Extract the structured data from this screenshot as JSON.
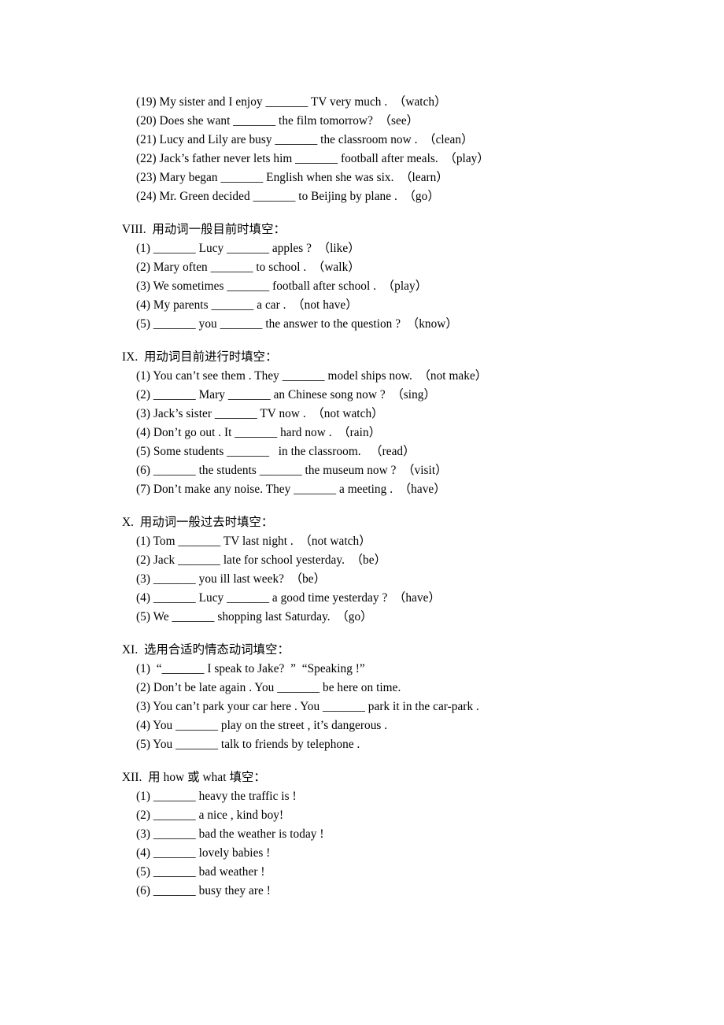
{
  "document": {
    "blocks": [
      {
        "id": "continuation-items",
        "heading": "",
        "items": [
          "(19) My sister and I enjoy _______ TV very much .  （watch）",
          "(20) Does she want _______ the film tomorrow?  （see）",
          "(21) Lucy and Lily are busy _______ the classroom now .  （clean）",
          "(22) Jack’s father never lets him _______ football after meals.  （play）",
          "(23) Mary began _______ English when she was six.  （learn）",
          "(24) Mr. Green decided _______ to Beijing by plane .  （go）"
        ]
      },
      {
        "id": "section-viii",
        "heading": "VIII.  用动词一般目前时填空：",
        "items": [
          "(1) _______ Lucy _______ apples ?  （like）",
          "(2) Mary often _______ to school .  （walk）",
          "(3) We sometimes _______ football after school .  （play）",
          "(4) My parents _______ a car .  （not have）",
          "(5) _______ you _______ the answer to the question ?  （know）"
        ]
      },
      {
        "id": "section-ix",
        "heading": "IX.  用动词目前进行时填空：",
        "items": [
          "(1) You can’t see them . They _______ model ships now.  （not make）",
          "(2) _______ Mary _______ an Chinese song now ?  （sing）",
          "(3) Jack’s sister _______ TV now .  （not watch）",
          "(4) Don’t go out . It _______ hard now .  （rain）",
          "(5) Some students _______   in the classroom.   （read）",
          "(6) _______ the students _______ the museum now ?  （visit）",
          "(7) Don’t make any noise. They _______ a meeting .  （have）"
        ]
      },
      {
        "id": "section-x",
        "heading": "X.  用动词一般过去时填空：",
        "items": [
          "(1) Tom _______ TV last night .  （not watch）",
          "(2) Jack _______ late for school yesterday.  （be）",
          "(3) _______ you ill last week?  （be）",
          "(4) _______ Lucy _______ a good time yesterday ?  （have）",
          "(5) We _______ shopping last Saturday.  （go）"
        ]
      },
      {
        "id": "section-xi",
        "heading": "XI.  选用合适旳情态动词填空：",
        "items": [
          "(1)  “_______ I speak to Jake?  ”  “Speaking !”",
          "(2) Don’t be late again . You _______ be here on time.",
          "(3) You can’t park your car here . You _______ park it in the car-park .",
          "(4) You _______ play on the street , it’s dangerous .",
          "(5) You _______ talk to friends by telephone ."
        ]
      },
      {
        "id": "section-xii",
        "heading": "XII.  用 how 或 what 填空：",
        "items": [
          "(1) _______ heavy the traffic is !",
          "(2) _______ a nice , kind boy!",
          "(3) _______ bad the weather is today !",
          "(4) _______ lovely babies !",
          "(5) _______ bad weather !",
          "(6) _______ busy they are !"
        ]
      }
    ]
  }
}
